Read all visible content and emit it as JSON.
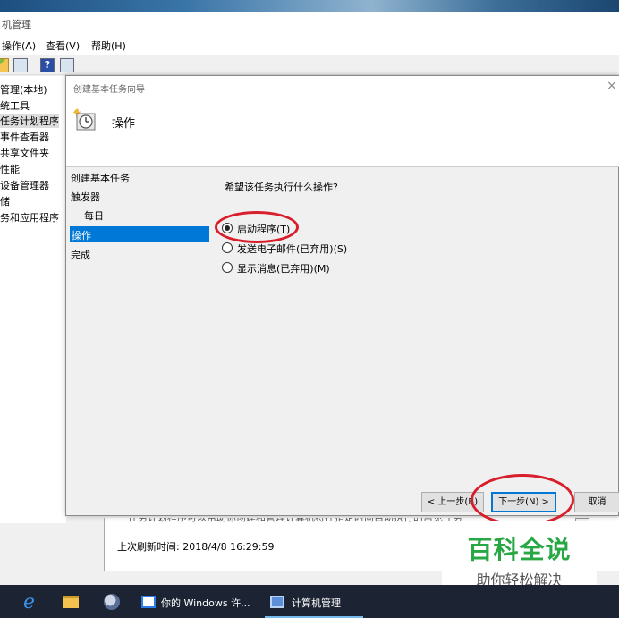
{
  "parent_window": {
    "title": "机管理",
    "menu": [
      "操作(A)",
      "查看(V)",
      "帮助(H)"
    ],
    "tree": [
      "管理(本地)",
      "统工具",
      "任务计划程序",
      "事件查看器",
      "共享文件夹",
      "性能",
      "设备管理器",
      "储",
      "务和应用程序"
    ],
    "hint_cut": "任务计划程序可以帮助你创建和管理计算机将在指定时间自动执行的常见任务",
    "refresh": "上次刷新时间: 2018/4/8 16:29:59"
  },
  "wizard": {
    "title": "创建基本任务向导",
    "heading": "操作",
    "steps": [
      "创建基本任务",
      "触发器",
      "每日",
      "操作",
      "完成"
    ],
    "question": "希望该任务执行什么操作?",
    "options": [
      "启动程序(T)",
      "发送电子邮件(已弃用)(S)",
      "显示消息(已弃用)(M)"
    ],
    "selected_option": "启动程序(T)",
    "buttons": {
      "back": "< 上一步(B)",
      "next": "下一步(N) >",
      "cancel": "取消"
    },
    "close_glyph": "×"
  },
  "watermark": {
    "main": "百科全说",
    "sub": "助你轻松解决"
  },
  "taskbar": {
    "ie_glyph": "e",
    "items": [
      "你的 Windows 许...",
      "计算机管理"
    ]
  },
  "colors": {
    "accent": "#0078d7",
    "annotation": "#d81e2a",
    "watermark": "#28a745"
  }
}
